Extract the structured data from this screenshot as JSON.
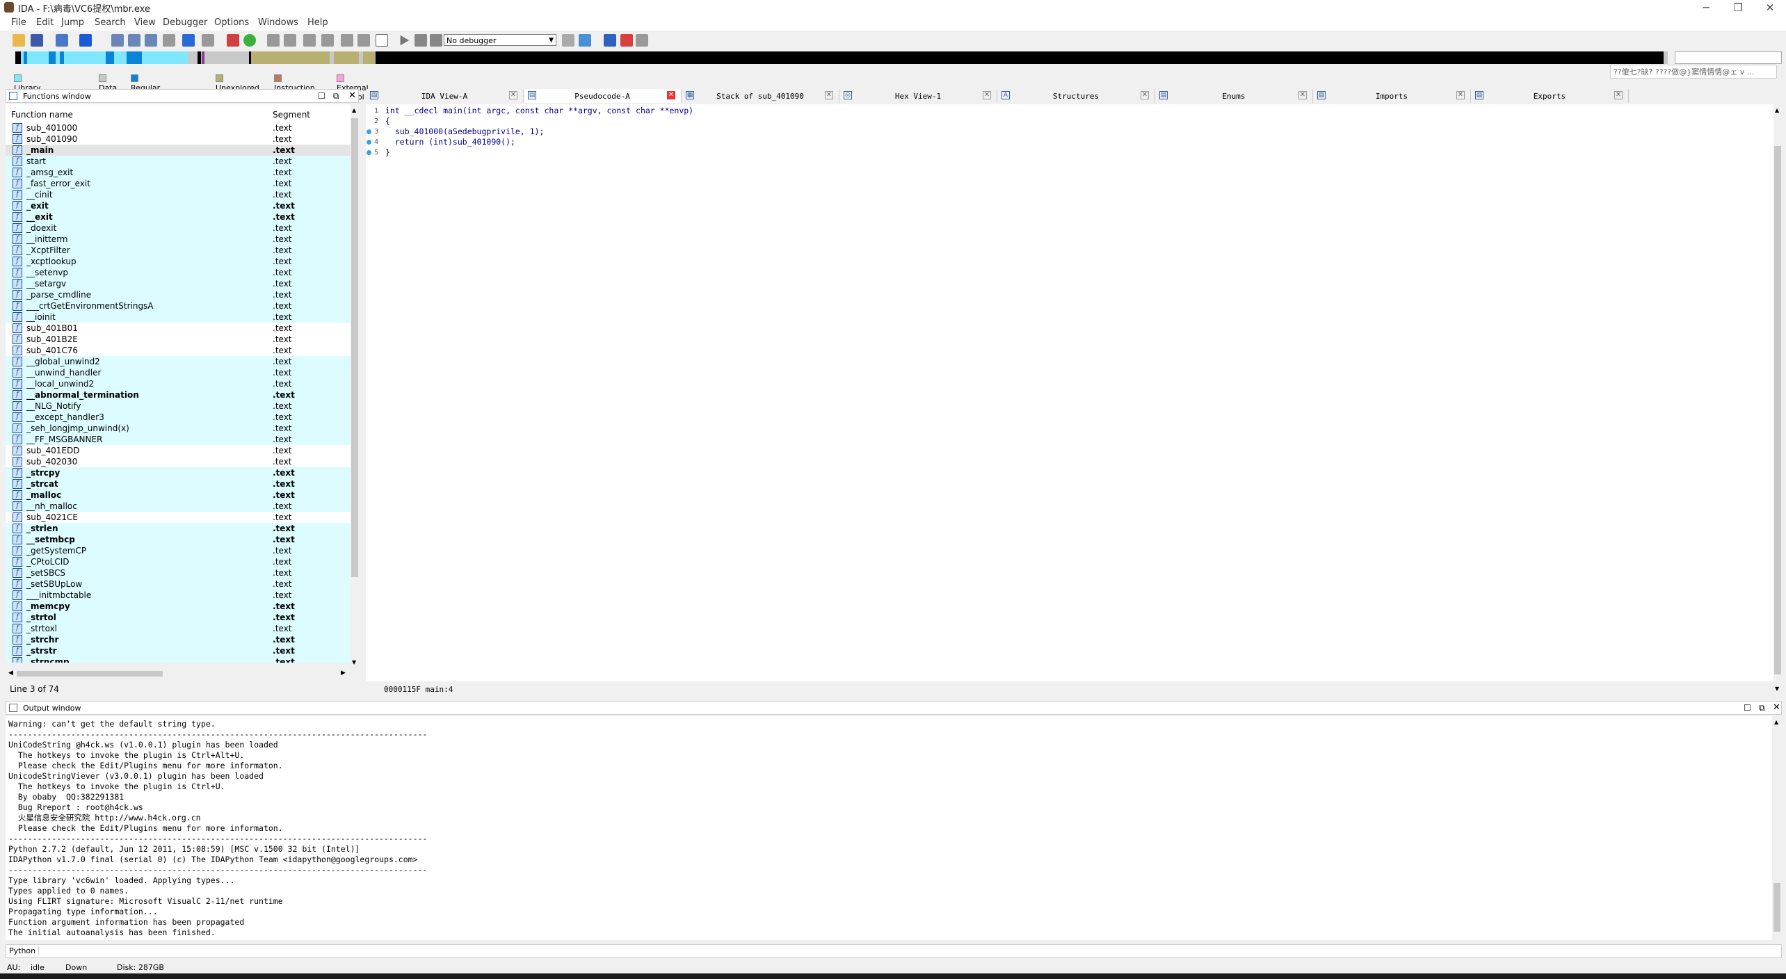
{
  "window": {
    "title": "IDA - F:\\病毒\\VC6提权\\mbr.exe",
    "controls": [
      "─",
      "❐",
      "✕"
    ]
  },
  "menu": [
    "File",
    "Edit",
    "Jump",
    "Search",
    "View",
    "Debugger",
    "Options",
    "Windows",
    "Help"
  ],
  "toolbar": {
    "debugger_select": "No debugger"
  },
  "legend": [
    {
      "label": "Library function",
      "color": "#7fe8ff"
    },
    {
      "label": "Data",
      "color": "#c8c8c8"
    },
    {
      "label": "Regular function",
      "color": "#0a84d8"
    },
    {
      "label": "Unexplored",
      "color": "#b8b070"
    },
    {
      "label": "Instruction",
      "color": "#c07858"
    },
    {
      "label": "External symbol",
      "color": "#ff9ee0"
    }
  ],
  "hint_text": "??傻七?缺? ????做@}窦情情情@ェ v ...",
  "functions_window": {
    "title": "Functions window",
    "col_name": "Function name",
    "col_segment": "Segment",
    "status": "Line 3 of 74",
    "rows": [
      {
        "name": "sub_401000",
        "seg": ".text",
        "bold": false,
        "lib": false
      },
      {
        "name": "sub_401090",
        "seg": ".text",
        "bold": false,
        "lib": false
      },
      {
        "name": "_main",
        "seg": ".text",
        "bold": true,
        "lib": false,
        "selected": true
      },
      {
        "name": "start",
        "seg": ".text",
        "bold": false,
        "lib": true
      },
      {
        "name": "_amsg_exit",
        "seg": ".text",
        "bold": false,
        "lib": true
      },
      {
        "name": "_fast_error_exit",
        "seg": ".text",
        "bold": false,
        "lib": true
      },
      {
        "name": "__cinit",
        "seg": ".text",
        "bold": false,
        "lib": true
      },
      {
        "name": "_exit",
        "seg": ".text",
        "bold": true,
        "lib": true
      },
      {
        "name": "__exit",
        "seg": ".text",
        "bold": true,
        "lib": true
      },
      {
        "name": "_doexit",
        "seg": ".text",
        "bold": false,
        "lib": true
      },
      {
        "name": "__initterm",
        "seg": ".text",
        "bold": false,
        "lib": true
      },
      {
        "name": "_XcptFilter",
        "seg": ".text",
        "bold": false,
        "lib": true
      },
      {
        "name": "_xcptlookup",
        "seg": ".text",
        "bold": false,
        "lib": true
      },
      {
        "name": "__setenvp",
        "seg": ".text",
        "bold": false,
        "lib": true
      },
      {
        "name": "__setargv",
        "seg": ".text",
        "bold": false,
        "lib": true
      },
      {
        "name": "_parse_cmdline",
        "seg": ".text",
        "bold": false,
        "lib": true
      },
      {
        "name": "___crtGetEnvironmentStringsA",
        "seg": ".text",
        "bold": false,
        "lib": true
      },
      {
        "name": "__ioinit",
        "seg": ".text",
        "bold": false,
        "lib": true
      },
      {
        "name": "sub_401B01",
        "seg": ".text",
        "bold": false,
        "lib": false
      },
      {
        "name": "sub_401B2E",
        "seg": ".text",
        "bold": false,
        "lib": false
      },
      {
        "name": "sub_401C76",
        "seg": ".text",
        "bold": false,
        "lib": false
      },
      {
        "name": "__global_unwind2",
        "seg": ".text",
        "bold": false,
        "lib": true
      },
      {
        "name": "__unwind_handler",
        "seg": ".text",
        "bold": false,
        "lib": true
      },
      {
        "name": "__local_unwind2",
        "seg": ".text",
        "bold": false,
        "lib": true
      },
      {
        "name": "__abnormal_termination",
        "seg": ".text",
        "bold": true,
        "lib": true
      },
      {
        "name": "__NLG_Notify",
        "seg": ".text",
        "bold": false,
        "lib": true
      },
      {
        "name": "__except_handler3",
        "seg": ".text",
        "bold": false,
        "lib": true
      },
      {
        "name": "_seh_longjmp_unwind(x)",
        "seg": ".text",
        "bold": false,
        "lib": true
      },
      {
        "name": "__FF_MSGBANNER",
        "seg": ".text",
        "bold": false,
        "lib": true
      },
      {
        "name": "sub_401EDD",
        "seg": ".text",
        "bold": false,
        "lib": false
      },
      {
        "name": "sub_402030",
        "seg": ".text",
        "bold": false,
        "lib": false
      },
      {
        "name": "_strcpy",
        "seg": ".text",
        "bold": true,
        "lib": true
      },
      {
        "name": "_strcat",
        "seg": ".text",
        "bold": true,
        "lib": true
      },
      {
        "name": "_malloc",
        "seg": ".text",
        "bold": true,
        "lib": true
      },
      {
        "name": "__nh_malloc",
        "seg": ".text",
        "bold": false,
        "lib": true
      },
      {
        "name": "sub_4021CE",
        "seg": ".text",
        "bold": false,
        "lib": false
      },
      {
        "name": "_strlen",
        "seg": ".text",
        "bold": true,
        "lib": true
      },
      {
        "name": "__setmbcp",
        "seg": ".text",
        "bold": true,
        "lib": true
      },
      {
        "name": "_getSystemCP",
        "seg": ".text",
        "bold": false,
        "lib": true
      },
      {
        "name": "_CPtoLCID",
        "seg": ".text",
        "bold": false,
        "lib": true
      },
      {
        "name": "_setSBCS",
        "seg": ".text",
        "bold": false,
        "lib": true
      },
      {
        "name": "_setSBUpLow",
        "seg": ".text",
        "bold": false,
        "lib": true
      },
      {
        "name": "___initmbctable",
        "seg": ".text",
        "bold": false,
        "lib": true
      },
      {
        "name": "_memcpy",
        "seg": ".text",
        "bold": true,
        "lib": true
      },
      {
        "name": "_strtol",
        "seg": ".text",
        "bold": true,
        "lib": true
      },
      {
        "name": "_strtoxl",
        "seg": ".text",
        "bold": false,
        "lib": true
      },
      {
        "name": "_strchr",
        "seg": ".text",
        "bold": true,
        "lib": true
      },
      {
        "name": "_strstr",
        "seg": ".text",
        "bold": true,
        "lib": true
      },
      {
        "name": "_strncmp",
        "seg": ".text",
        "bold": true,
        "lib": true
      }
    ]
  },
  "tabs": [
    {
      "label": "IDA View-A",
      "icon": "ida-view-icon",
      "active": false
    },
    {
      "label": "Pseudocode-A",
      "icon": "pseudocode-icon",
      "active": true
    },
    {
      "label": "Stack of sub_401090",
      "icon": "stack-icon",
      "active": false
    },
    {
      "label": "Hex View-1",
      "icon": "hex-icon",
      "active": false
    },
    {
      "label": "Structures",
      "icon": "structures-icon",
      "active": false
    },
    {
      "label": "Enums",
      "icon": "enums-icon",
      "active": false
    },
    {
      "label": "Imports",
      "icon": "imports-icon",
      "active": false
    },
    {
      "label": "Exports",
      "icon": "exports-icon",
      "active": false
    }
  ],
  "pseudocode": {
    "lines": [
      {
        "num": "1",
        "text": "int __cdecl main(int argc, const char **argv, const char **envp)",
        "dot": false
      },
      {
        "num": "2",
        "text": "{",
        "dot": false
      },
      {
        "num": "3",
        "text": "  sub_401000(aSedebugprivile, 1);",
        "dot": true
      },
      {
        "num": "4",
        "text": "  return (int)sub_401090();",
        "dot": true
      },
      {
        "num": "5",
        "text": "}",
        "dot": true
      }
    ],
    "status": "0000115F main:4"
  },
  "output_window": {
    "title": "Output window",
    "lines": [
      "Warning: can't get the default string type.",
      "---------------------------------------------------------------------------------------",
      "UniCodeString @h4ck.ws (v1.0.0.1) plugin has been loaded",
      "  The hotkeys to invoke the plugin is Ctrl+Alt+U.",
      "  Please check the Edit/Plugins menu for more informaton.",
      "UnicodeStringViever (v3.0.0.1) plugin has been loaded",
      "  The hotkeys to invoke the plugin is Ctrl+U.",
      "  By obaby  QQ:382291381",
      "  Bug Rreport : root@h4ck.ws",
      "  火星信息安全研究院 http://www.h4ck.org.cn",
      "  Please check the Edit/Plugins menu for more informaton.",
      "---------------------------------------------------------------------------------------",
      "Python 2.7.2 (default, Jun 12 2011, 15:08:59) [MSC v.1500 32 bit (Intel)]",
      "IDAPython v1.7.0 final (serial 0) (c) The IDAPython Team <idapython@googlegroups.com>",
      "---------------------------------------------------------------------------------------",
      "Type library 'vc6win' loaded. Applying types...",
      "Types applied to 0 names.",
      "Using FLIRT signature: Microsoft VisualC 2-11/net runtime",
      "Propagating type information...",
      "Function argument information has been propagated",
      "The initial autoanalysis has been finished."
    ]
  },
  "python_label": "Python",
  "statusbar": {
    "au": "AU:",
    "state": "idle",
    "dir": "Down",
    "disk": "Disk: 287GB"
  }
}
